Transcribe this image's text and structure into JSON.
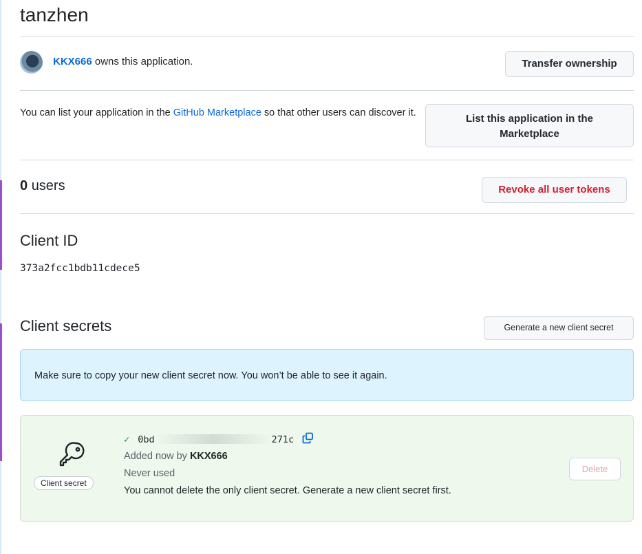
{
  "app": {
    "name": "tanzhen"
  },
  "owner": {
    "username": "KKX666",
    "text": "owns this application."
  },
  "buttons": {
    "transfer": "Transfer ownership",
    "list_marketplace": "List this application in the Marketplace",
    "revoke": "Revoke all user tokens",
    "generate_secret": "Generate a new client secret",
    "delete": "Delete"
  },
  "marketplace": {
    "prefix": "You can list your application in the",
    "link": "GitHub Marketplace",
    "suffix": "so that other users can discover it."
  },
  "users": {
    "count": "0",
    "label": "users"
  },
  "client_id": {
    "heading": "Client ID",
    "value": "373a2fcc1bdb11cdece5"
  },
  "client_secrets": {
    "heading": "Client secrets",
    "flash": "Make sure to copy your new client secret now. You won’t be able to see it again.",
    "item": {
      "badge": "Client secret",
      "secret_start": "0bd",
      "secret_end": "271c",
      "added_prefix": "Added now by",
      "added_by": "KKX666",
      "usage": "Never used",
      "warning": "You cannot delete the only client secret. Generate a new client secret first."
    }
  },
  "icons": {
    "check": "check-icon",
    "copy": "copy-icon",
    "key": "key-icon",
    "avatar": "avatar"
  },
  "colors": {
    "link": "#0969da",
    "danger": "#cf222e",
    "success": "#1a7f37",
    "flash_bg": "#ddf4ff",
    "secret_bg": "#eef8ec"
  }
}
